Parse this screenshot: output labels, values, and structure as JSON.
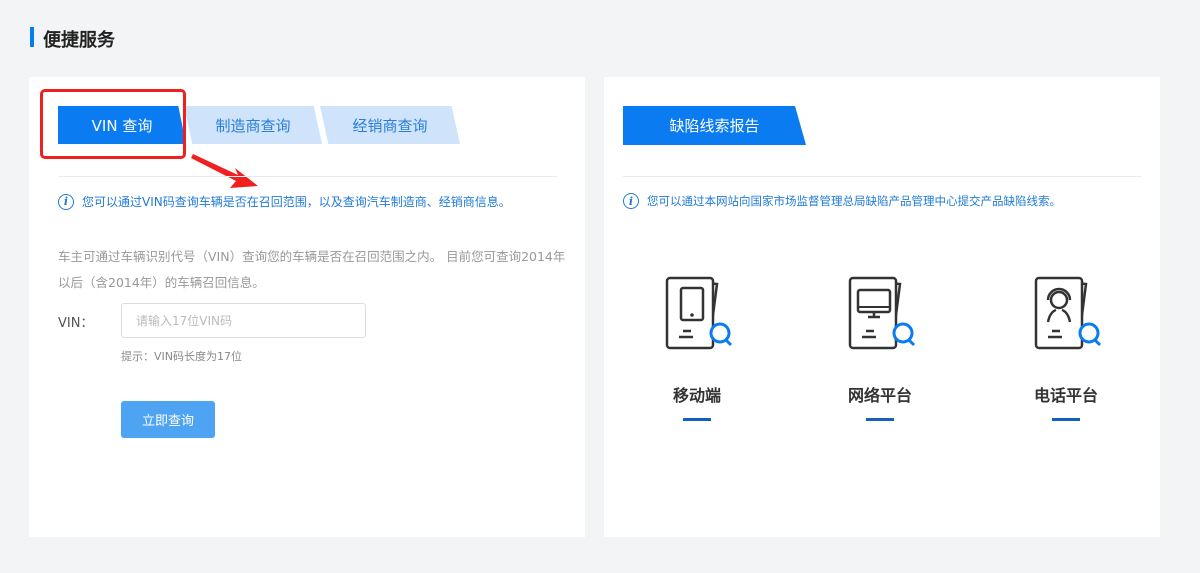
{
  "section_title": "便捷服务",
  "left_panel": {
    "tabs": [
      {
        "label": "VIN 查询",
        "active": true
      },
      {
        "label": "制造商查询",
        "active": false
      },
      {
        "label": "经销商查询",
        "active": false
      }
    ],
    "info": "您可以通过VIN码查询车辆是否在召回范围，以及查询汽车制造商、经销商信息。",
    "description": "车主可通过车辆识别代号（VIN）查询您的车辆是否在召回范围之内。 目前您可查询2014年以后（含2014年）的车辆召回信息。",
    "vin_label": "VIN：",
    "vin_placeholder": "请输入17位VIN码",
    "vin_value": "",
    "hint": "提示：VIN码长度为17位",
    "submit_label": "立即查询"
  },
  "right_panel": {
    "tab_label": "缺陷线索报告",
    "info": "您可以通过本网站向国家市场监督管理总局缺陷产品管理中心提交产品缺陷线索。",
    "channels": [
      {
        "label": "移动端",
        "icon": "mobile-document-search-icon"
      },
      {
        "label": "网络平台",
        "icon": "monitor-document-search-icon"
      },
      {
        "label": "电话平台",
        "icon": "headset-document-search-icon"
      }
    ]
  },
  "colors": {
    "primary": "#0a7bf0",
    "tab_idle": "#cfe3fb",
    "annotation": "#f02020",
    "button": "#4ea4f2"
  }
}
